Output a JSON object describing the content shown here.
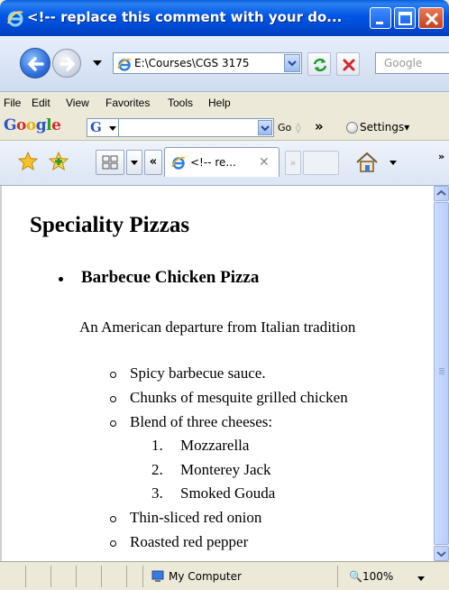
{
  "window": {
    "title": "<!-- replace this comment with your do...",
    "icon": "ie-icon"
  },
  "address_bar": {
    "url": "E:\\Courses\\CGS 3175",
    "search_placeholder": "Google"
  },
  "menu": [
    "File",
    "Edit",
    "View",
    "Favorites",
    "Tools",
    "Help"
  ],
  "google_toolbar": {
    "logo": [
      "G",
      "o",
      "o",
      "g",
      "l",
      "e"
    ],
    "logo_colors": [
      "#2b55c8",
      "#d22d2d",
      "#e8b400",
      "#2b55c8",
      "#2a9a2a",
      "#d22d2d"
    ],
    "go_label": "Go",
    "chevrons": "»",
    "settings_label": "Settings▾"
  },
  "tabs": {
    "active_tab_label": "<!-- re...",
    "scroll_left": "«",
    "scroll_right": "»",
    "more": "»"
  },
  "content": {
    "heading": "Speciality Pizzas",
    "pizza_name": "Barbecue Chicken Pizza",
    "description": "An American departure from Italian tradition",
    "ingredients": [
      "Spicy barbecue sauce.",
      "Chunks of mesquite grilled chicken",
      "Blend of three cheeses:",
      "Thin-sliced red onion",
      "Roasted red pepper"
    ],
    "cheeses": [
      {
        "num": "1.",
        "name": "Mozzarella"
      },
      {
        "num": "2.",
        "name": "Monterey Jack"
      },
      {
        "num": "3.",
        "name": "Smoked Gouda"
      }
    ]
  },
  "status_bar": {
    "zone": "My Computer",
    "zoom": "100%"
  },
  "colors": {
    "title_bar": "#0055e5",
    "toolbar_bg": "#ece9d8"
  }
}
